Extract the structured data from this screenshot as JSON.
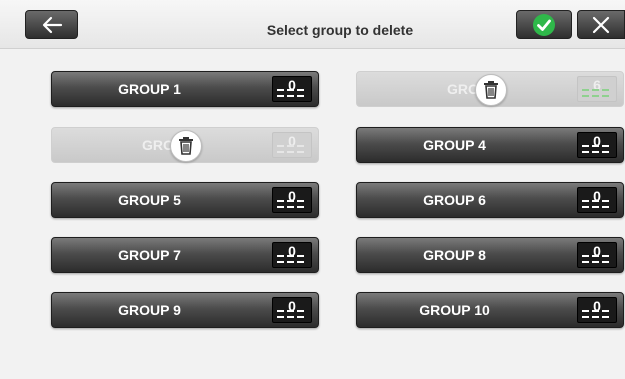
{
  "header": {
    "title": "Select group to delete",
    "back_icon": "arrow-left-icon",
    "confirm_icon": "checkmark-icon",
    "close_icon": "close-icon",
    "confirm_color": "#2fb84a"
  },
  "groups": [
    {
      "label": "GROUP 1",
      "count": "0",
      "state": "normal"
    },
    {
      "label": "GROU",
      "count": "6",
      "state": "selected",
      "count_line_color": "#8fd18f"
    },
    {
      "label": "GROU",
      "count": "0",
      "state": "selected"
    },
    {
      "label": "GROUP 4",
      "count": "0",
      "state": "normal"
    },
    {
      "label": "GROUP 5",
      "count": "0",
      "state": "normal"
    },
    {
      "label": "GROUP 6",
      "count": "0",
      "state": "normal"
    },
    {
      "label": "GROUP 7",
      "count": "0",
      "state": "normal"
    },
    {
      "label": "GROUP 8",
      "count": "0",
      "state": "normal"
    },
    {
      "label": "GROUP 9",
      "count": "0",
      "state": "normal"
    },
    {
      "label": "GROUP 10",
      "count": "0",
      "state": "normal"
    }
  ]
}
